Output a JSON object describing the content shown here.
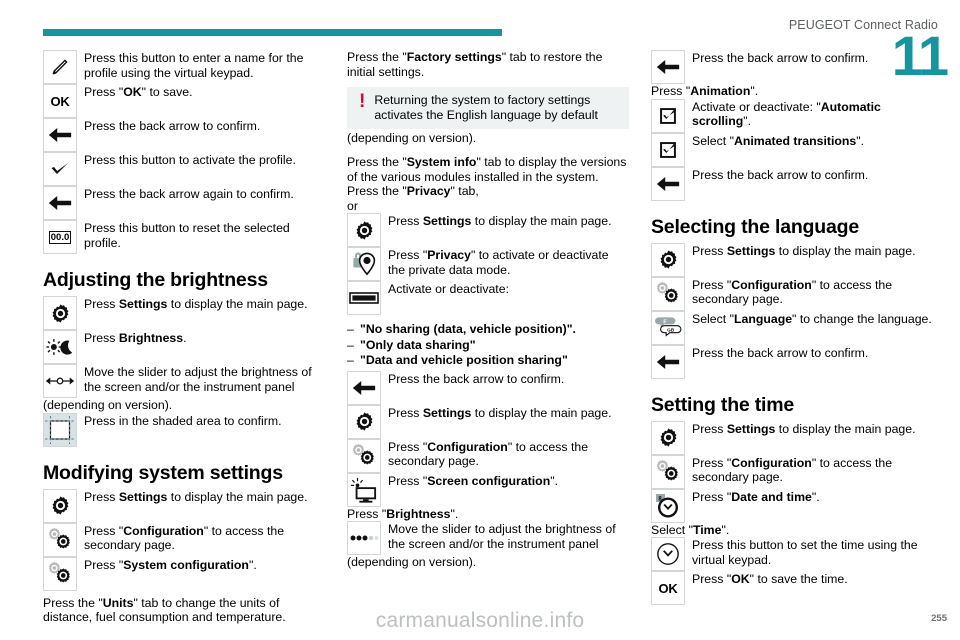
{
  "header": {
    "title": "PEUGEOT Connect Radio",
    "chapter": "11"
  },
  "footer": {
    "watermark": "carmanualsonline.info",
    "page_number": "255"
  },
  "col1": {
    "rows": [
      {
        "icon": "pencil-icon",
        "text_html": "Press this button to enter a name for the profile using the virtual keypad."
      },
      {
        "icon": "ok-icon",
        "text_html": "Press \"<b>OK</b>\" to save."
      },
      {
        "icon": "back-arrow-icon",
        "text_html": "Press the back arrow to confirm."
      },
      {
        "icon": "checkmark-icon",
        "text_html": "Press this button to activate the profile."
      },
      {
        "icon": "back-arrow-icon",
        "text_html": "Press the back arrow again to confirm."
      },
      {
        "icon": "reset-trip-icon",
        "text_html": "Press this button to reset the selected profile."
      }
    ],
    "heading_brightness": "Adjusting the brightness",
    "brightness_rows": [
      {
        "icon": "settings-gear-icon",
        "text_html": "Press <b>Settings</b> to display the main page."
      },
      {
        "icon": "brightness-day-night-icon",
        "text_html": "Press <b>Brightness</b>."
      },
      {
        "icon": "slider-icon",
        "text_html": "Move the slider to adjust the brightness of the screen and/or the instrument panel"
      }
    ],
    "brightness_tail": "(depending on version).",
    "shaded_row": {
      "icon": "shaded-area-icon",
      "text_html": "Press in the shaded area to confirm."
    },
    "heading_system": "Modifying system settings",
    "system_rows": [
      {
        "icon": "settings-gear-icon",
        "text_html": "Press <b>Settings</b> to display the main page."
      },
      {
        "icon": "configuration-gears-icon",
        "text_html": "Press \"<b>Configuration</b>\" to access the secondary page."
      },
      {
        "icon": "configuration-gears-icon",
        "text_html": "Press \"<b>System configuration</b>\"."
      }
    ],
    "units_text_html": "Press the \"<b>Units</b>\" tab to change the units of distance, fuel consumption and temperature."
  },
  "col2": {
    "factory_text_html": "Press the \"<b>Factory settings</b>\" tab to restore the initial settings.",
    "warning": {
      "icon": "warning-exclamation-icon",
      "text": "Returning the system to factory settings activates the English language by default",
      "tail": "(depending on version)."
    },
    "sysinfo_text_html": "Press the \"<b>System info</b>\" tab to display the versions of the various modules installed in the system.",
    "privacy_text_html": "Press the \"<b>Privacy</b>\" tab,",
    "or_text": "or",
    "privacy_rows": [
      {
        "icon": "settings-gear-icon",
        "text_html": "Press <b>Settings</b> to display the main page."
      },
      {
        "icon": "privacy-lock-pin-icon",
        "text_html": "Press \"<b>Privacy</b>\" to activate or deactivate the private data mode."
      },
      {
        "icon": "toggle-switch-icon",
        "text_html": "Activate or deactivate:"
      }
    ],
    "sharing_options": [
      "\"No sharing (data, vehicle position)\".",
      "\"Only data sharing\"",
      "\"Data and vehicle position sharing\""
    ],
    "back_row": {
      "icon": "back-arrow-icon",
      "text_html": "Press the back arrow to confirm."
    },
    "screen_rows": [
      {
        "icon": "settings-gear-icon",
        "text_html": "Press <b>Settings</b> to display the main page."
      },
      {
        "icon": "configuration-gears-icon",
        "text_html": "Press \"<b>Configuration</b>\" to access the secondary page."
      },
      {
        "icon": "screen-config-icon",
        "text_html": "Press \"<b>Screen configuration</b>\"."
      }
    ],
    "brightness_text_html": "Press \"<b>Brightness</b>\".",
    "slider_row": {
      "icon": "dots-slider-icon",
      "text_html": "Move the slider to adjust the brightness of the screen and/or the instrument panel"
    },
    "slider_tail": "(depending on version)."
  },
  "col3": {
    "back_row": {
      "icon": "back-arrow-icon",
      "text_html": "Press the back arrow to confirm."
    },
    "animation_text_html": "Press \"<b>Animation</b>\".",
    "animation_rows": [
      {
        "icon": "checkbox-checked-icon",
        "text_html": "Activate or deactivate: \"<b>Automatic scrolling</b>\"."
      },
      {
        "icon": "checkbox-checked-icon",
        "text_html": "Select \"<b>Animated transitions</b>\"."
      },
      {
        "icon": "back-arrow-icon",
        "text_html": "Press the back arrow to confirm."
      }
    ],
    "heading_language": "Selecting the language",
    "language_rows": [
      {
        "icon": "settings-gear-icon",
        "text_html": "Press <b>Settings</b> to display the main page."
      },
      {
        "icon": "configuration-gears-icon",
        "text_html": "Press \"<b>Configuration</b>\" to access the secondary page."
      },
      {
        "icon": "language-bubbles-icon",
        "text_html": "Select \"<b>Language</b>\" to change the language."
      },
      {
        "icon": "back-arrow-icon",
        "text_html": "Press the back arrow to confirm."
      }
    ],
    "heading_time": "Setting the time",
    "time_rows": [
      {
        "icon": "settings-gear-icon",
        "text_html": "Press <b>Settings</b> to display the main page."
      },
      {
        "icon": "configuration-gears-icon",
        "text_html": "Press \"<b>Configuration</b>\" to access the secondary page."
      },
      {
        "icon": "date-time-clock-icon",
        "text_html": "Press \"<b>Date and time</b>\"."
      }
    ],
    "select_time_html": "Select \"<b>Time</b>\".",
    "time_rows2": [
      {
        "icon": "clock-icon",
        "text_html": "Press this button to set the time using the virtual keypad."
      },
      {
        "icon": "ok-icon",
        "text_html": "Press \"<b>OK</b>\" to save the time."
      }
    ]
  },
  "colors": {
    "accent_teal": "#1694a0",
    "warning_red": "#e4032e",
    "warning_box_bg": "#eff2f3",
    "icon_border": "#d3d6d7"
  }
}
